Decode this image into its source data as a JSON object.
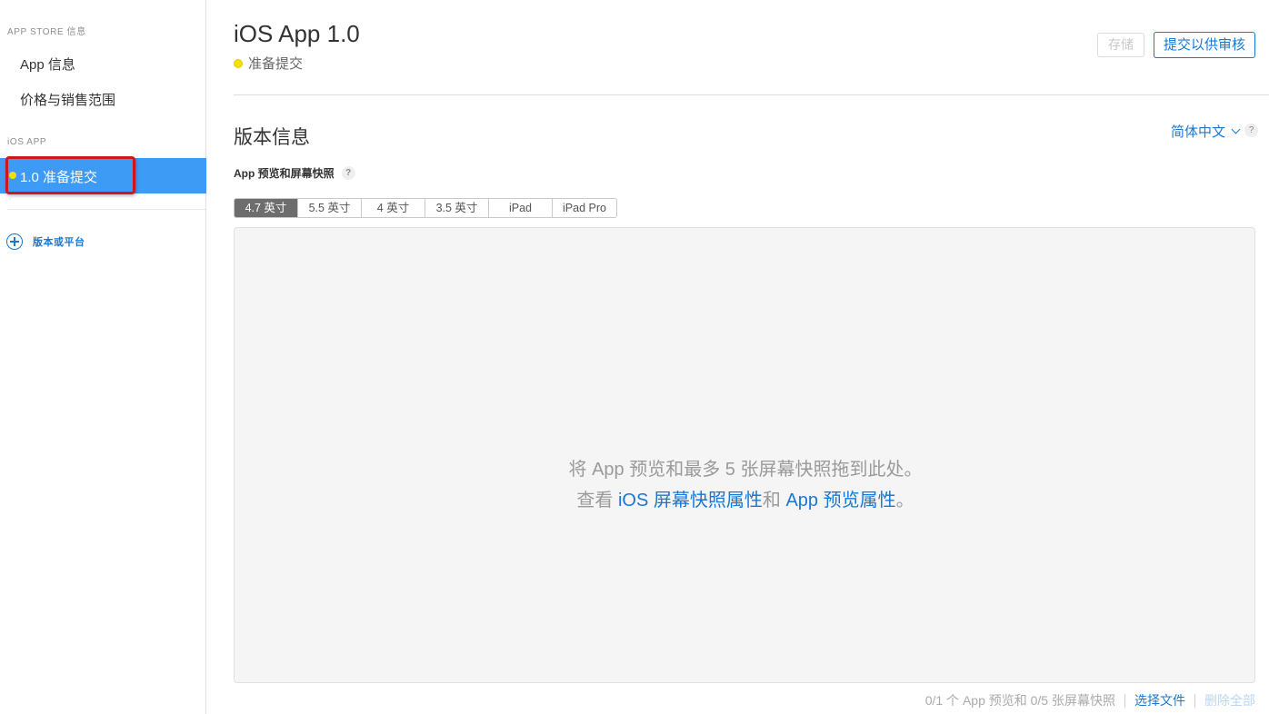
{
  "sidebar": {
    "section_appstore": "APP STORE 信息",
    "item_app_info": "App 信息",
    "item_pricing": "价格与销售范围",
    "section_ios": "iOS APP",
    "active_version_label": "1.0 准备提交",
    "add_version_label": "版本或平台"
  },
  "header": {
    "app_title": "iOS App 1.0",
    "status_text": "准备提交",
    "save_label": "存储",
    "submit_label": "提交以供审核"
  },
  "version_info": {
    "title": "版本信息",
    "language": "简体中文",
    "help_symbol": "?"
  },
  "preview": {
    "label": "App 预览和屏幕快照",
    "help_symbol": "?",
    "tabs": [
      "4.7 英寸",
      "5.5 英寸",
      "4 英寸",
      "3.5 英寸",
      "iPad",
      "iPad Pro"
    ],
    "active_tab": 0,
    "drop_text": "将 App 预览和最多 5 张屏幕快照拖到此处。",
    "see_prefix": "查看",
    "ios_attributes_link": "iOS 屏幕快照属性",
    "and_text": "和",
    "app_preview_link": "App 预览属性",
    "period": "。"
  },
  "footer": {
    "count_text": "0/1 个 App 预览和 0/5 张屏幕快照",
    "select_file": "选择文件",
    "delete_all": "删除全部"
  },
  "colors": {
    "accent": "#1a77d2",
    "active_row": "#3d9bf5",
    "status_dot": "#f5e100",
    "highlight_outline": "#d0161d"
  }
}
